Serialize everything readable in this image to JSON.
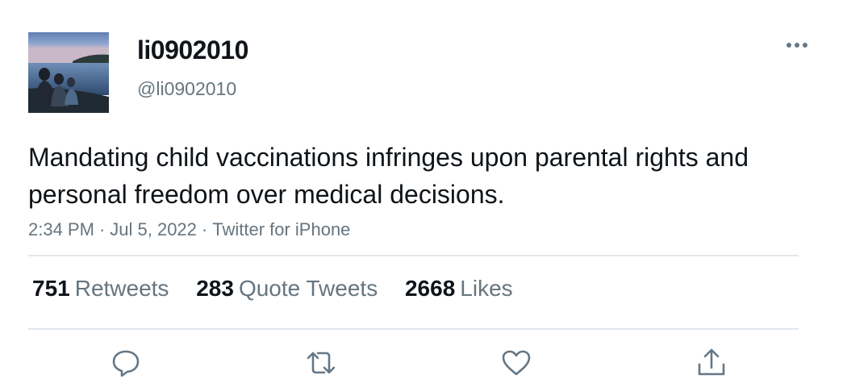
{
  "user": {
    "display_name": "li0902010",
    "handle": "@li0902010"
  },
  "tweet": {
    "text": "Mandating child vaccinations infringes upon parental rights and personal freedom over medical decisions.",
    "time": "2:34 PM",
    "date": "Jul 5, 2022",
    "source": "Twitter for iPhone",
    "separator": "·"
  },
  "stats": {
    "retweets": {
      "count": "751",
      "label": "Retweets"
    },
    "quotes": {
      "count": "283",
      "label": "Quote Tweets"
    },
    "likes": {
      "count": "2668",
      "label": "Likes"
    }
  },
  "icons": {
    "more": "more-dots-icon",
    "reply": "reply-icon",
    "retweet": "retweet-icon",
    "like": "heart-icon",
    "share": "share-icon"
  },
  "colors": {
    "text_primary": "#0f1419",
    "text_secondary": "#66757f",
    "icon": "#657786",
    "divider": "#e1e8ed"
  }
}
